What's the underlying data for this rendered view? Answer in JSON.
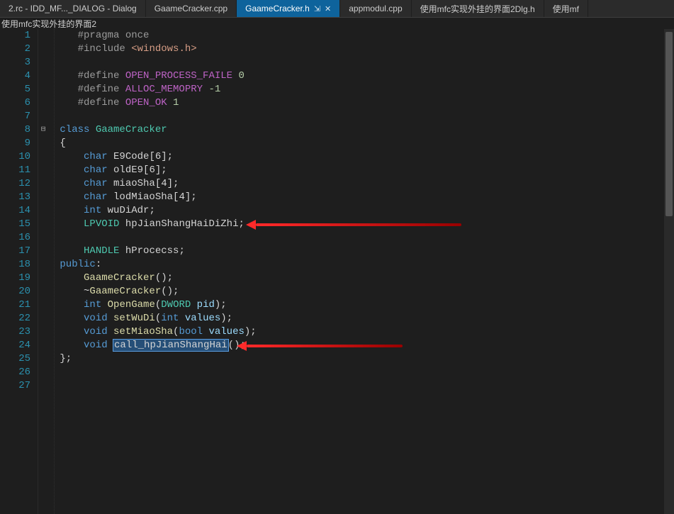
{
  "tabs": [
    {
      "label": "2.rc - IDD_MF..._DIALOG - Dialog",
      "active": false
    },
    {
      "label": "GaameCracker.cpp",
      "active": false
    },
    {
      "label": "GaameCracker.h",
      "active": true,
      "pinned": true,
      "closable": true
    },
    {
      "label": "appmodul.cpp",
      "active": false
    },
    {
      "label": "使用mfc实现外挂的界面2Dlg.h",
      "active": false
    },
    {
      "label": "使用mf",
      "active": false
    }
  ],
  "breadcrumb": "使用mfc实现外挂的界面2",
  "lines": {
    "l1": "1",
    "l2": "2",
    "l3": "3",
    "l4": "4",
    "l5": "5",
    "l6": "6",
    "l7": "7",
    "l8": "8",
    "l9": "9",
    "l10": "10",
    "l11": "11",
    "l12": "12",
    "l13": "13",
    "l14": "14",
    "l15": "15",
    "l16": "16",
    "l17": "17",
    "l18": "18",
    "l19": "19",
    "l20": "20",
    "l21": "21",
    "l22": "22",
    "l23": "23",
    "l24": "24",
    "l25": "25",
    "l26": "26",
    "l27": "27"
  },
  "code": {
    "pragma_once": {
      "dir": "#pragma",
      "rest": " once"
    },
    "include": {
      "dir": "#include",
      "rest": " ",
      "path": "<windows.h>"
    },
    "def1": {
      "dir": "#define",
      "name": " OPEN_PROCESS_FAILE",
      "val": " 0"
    },
    "def2": {
      "dir": "#define",
      "name": " ALLOC_MEMOPRY",
      "val": " -1"
    },
    "def3": {
      "dir": "#define",
      "name": " OPEN_OK",
      "val": " 1"
    },
    "classkw": "class",
    "classname": " GaameCracker",
    "brace_open": "{",
    "brace_close": "};",
    "member1": {
      "t": "char",
      "n": " E9Code",
      "b": "[6];"
    },
    "member2": {
      "t": "char",
      "n": " oldE9",
      "b": "[6];"
    },
    "member3": {
      "t": "char",
      "n": " miaoSha",
      "b": "[4];"
    },
    "member4": {
      "t": "char",
      "n": " lodMiaoSha",
      "b": "[4];"
    },
    "member5": {
      "t": "int",
      "n": " wuDiAdr",
      "b": ";"
    },
    "member6": {
      "t": "LPVOID",
      "n": " hpJianShangHaiDiZhi",
      "b": ";"
    },
    "member7": {
      "t": "HANDLE",
      "n": " hProcecss",
      "b": ";"
    },
    "public": "public",
    "ctor": {
      "n": "GaameCracker",
      "p": "();"
    },
    "dtor": {
      "pre": "~",
      "n": "GaameCracker",
      "p": "();"
    },
    "fn1": {
      "ret": "int",
      "n": " OpenGame",
      "lp": "(",
      "pt": "DWORD",
      "pn": " pid",
      "rp": ");"
    },
    "fn2": {
      "ret": "void",
      "n": " setWuDi",
      "lp": "(",
      "pt": "int",
      "pn": " values",
      "rp": ");"
    },
    "fn3": {
      "ret": "void",
      "n": " setMiaoSha",
      "lp": "(",
      "pt": "bool",
      "pn": " values",
      "rp": ");"
    },
    "fn4": {
      "ret": "void",
      "n_sel": "call_hpJianShangHai",
      "rp": "();"
    }
  },
  "selection": "call_hpJianShangHai",
  "colors": {
    "active_tab_bg": "#0e639c",
    "arrow": "#ff2a2a"
  },
  "glyphs": {
    "pin": "⇲",
    "close": "✕",
    "fold": "⊟"
  }
}
